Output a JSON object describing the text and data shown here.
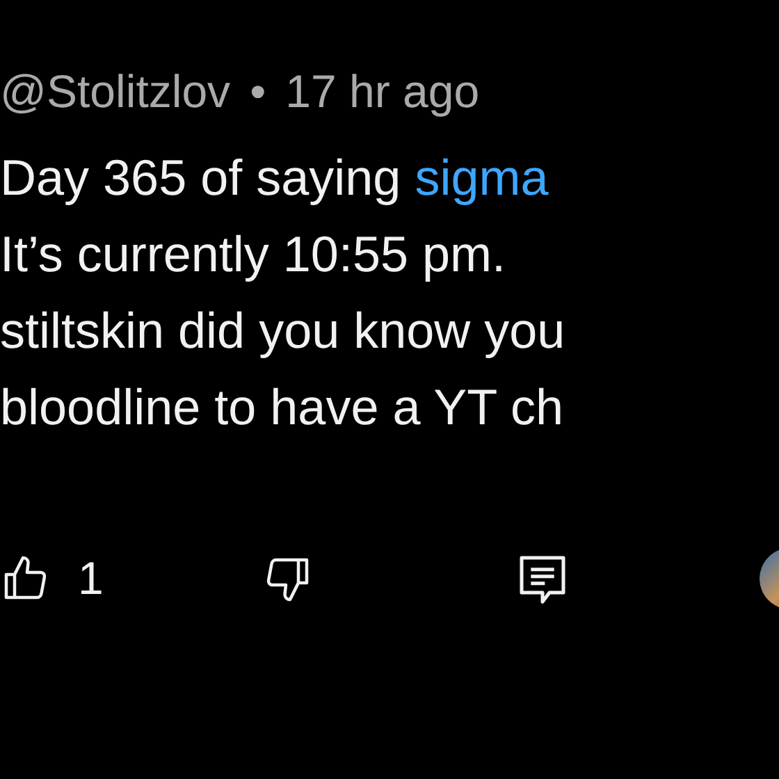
{
  "comment": {
    "author": "@Stolitzlov",
    "separator": "•",
    "time": "17 hr ago",
    "lines": [
      "Day 365 of saying",
      "It’s currently 10:55 pm.",
      "stiltskin did you know you",
      "bloodline to have a YT ch"
    ],
    "link": "sigma"
  },
  "actions": {
    "like_count": "1"
  }
}
